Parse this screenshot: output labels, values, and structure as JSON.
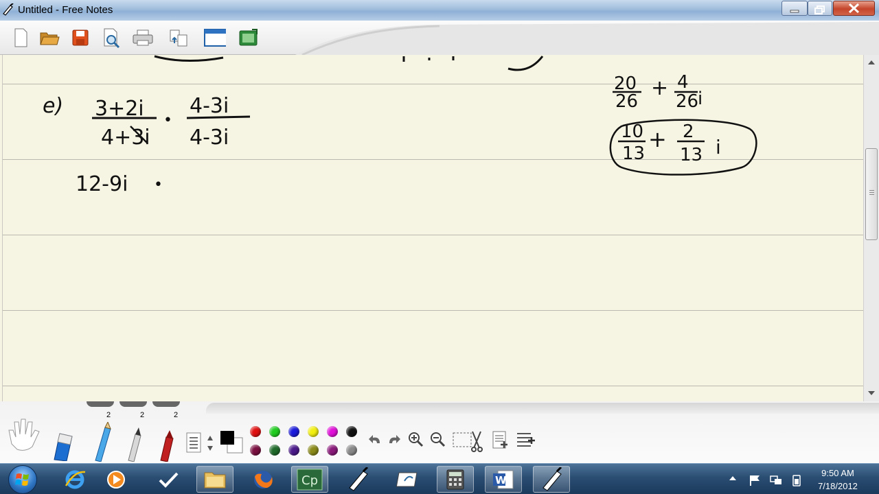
{
  "window": {
    "title": "Untitled - Free Notes"
  },
  "toolbar": {
    "buttons": [
      "new-file",
      "open-folder",
      "save",
      "print-preview",
      "print",
      "export",
      "fullscreen",
      "insert-image"
    ]
  },
  "notes": {
    "label_e": "e)",
    "lhs_num": "3+2i",
    "lhs_den": "4+3i",
    "dot": "•",
    "rhs_num": "4-3i",
    "rhs_den": "4-3i",
    "line2": "12-9i",
    "frac1_num": "20",
    "frac1_den": "26",
    "plus": "+",
    "frac2_num": "4",
    "frac2_den": "26",
    "i": "i",
    "ans1_num": "10",
    "ans1_den": "13",
    "ans2_num": "2",
    "ans2_den": "13"
  },
  "pen_sizes": [
    "2",
    "2",
    "2"
  ],
  "colors": {
    "palette_top": [
      "#e01010",
      "#1fcc1f",
      "#1a1adc",
      "#f2ef10",
      "#e010d8",
      "#111111"
    ],
    "palette_bottom": [
      "#7a1040",
      "#1f6a2a",
      "#4a1a8a",
      "#8a8a1a",
      "#8a1a7a",
      "#888888"
    ]
  },
  "taskbar": {
    "apps": [
      "internet-explorer",
      "media-player",
      "app-check",
      "file-explorer",
      "firefox",
      "captivate",
      "free-notes",
      "journal",
      "calculator",
      "word",
      "free-notes-active"
    ]
  },
  "clock": {
    "time": "9:50 AM",
    "date": "7/18/2012"
  }
}
